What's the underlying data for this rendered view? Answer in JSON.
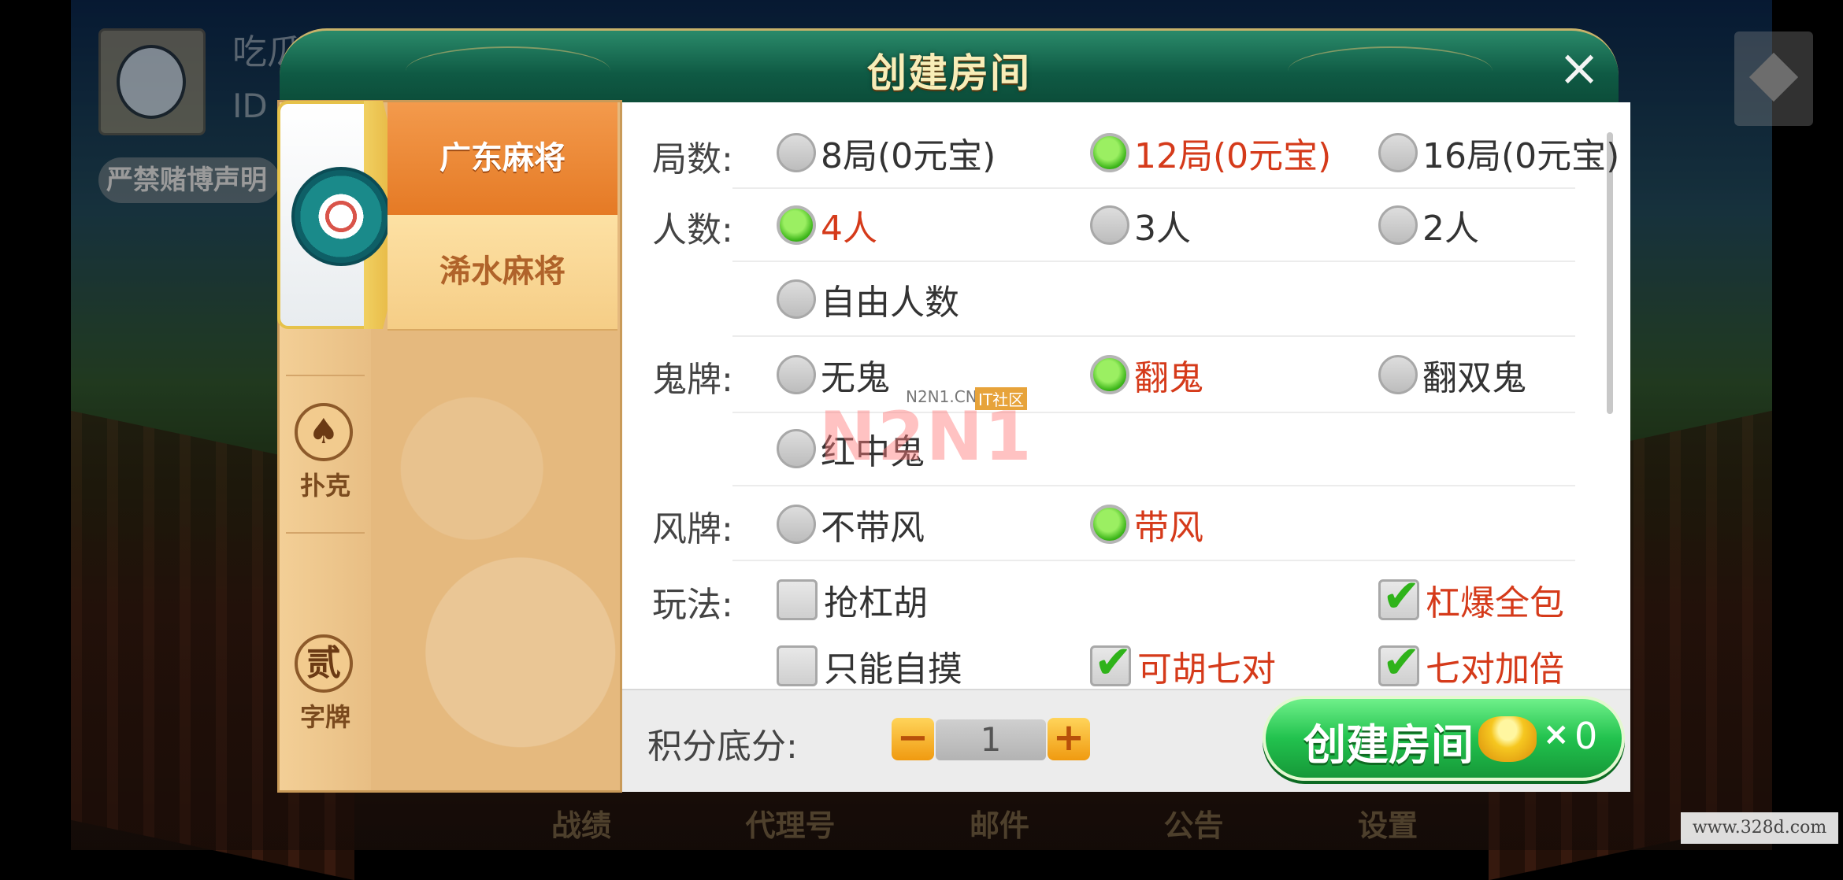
{
  "background": {
    "profile_name": "吃瓜群众",
    "profile_id": "ID",
    "notice": "严禁赌博声明",
    "bottom_nav": [
      "战绩",
      "代理号",
      "邮件",
      "公告",
      "设置"
    ],
    "site_watermark": "www.328d.com"
  },
  "dialog": {
    "title": "创建房间",
    "close_label": "×"
  },
  "categories": [
    {
      "icon": "mahjong-emblem-icon",
      "label": ""
    },
    {
      "icon": "spade-icon",
      "glyph": "♠",
      "label": "扑克"
    },
    {
      "icon": "er-icon",
      "glyph": "贰",
      "label": "字牌"
    }
  ],
  "game_tabs": [
    {
      "label": "广东麻将",
      "active": true
    },
    {
      "label": "浠水麻将",
      "active": false
    }
  ],
  "rules": {
    "rounds": {
      "label": "局数:",
      "options": [
        {
          "text": "8局(0元宝)",
          "selected": false
        },
        {
          "text": "12局(0元宝)",
          "selected": true
        },
        {
          "text": "16局(0元宝)",
          "selected": false
        }
      ]
    },
    "players": {
      "label": "人数:",
      "options": [
        {
          "text": "4人",
          "selected": true
        },
        {
          "text": "3人",
          "selected": false
        },
        {
          "text": "2人",
          "selected": false
        },
        {
          "text": "自由人数",
          "selected": false
        }
      ]
    },
    "ghost": {
      "label": "鬼牌:",
      "options": [
        {
          "text": "无鬼",
          "selected": false
        },
        {
          "text": "翻鬼",
          "selected": true
        },
        {
          "text": "翻双鬼",
          "selected": false
        },
        {
          "text": "红中鬼",
          "selected": false
        }
      ]
    },
    "wind": {
      "label": "风牌:",
      "options": [
        {
          "text": "不带风",
          "selected": false
        },
        {
          "text": "带风",
          "selected": true
        }
      ]
    },
    "play": {
      "label": "玩法:",
      "options": [
        {
          "text": "抢杠胡",
          "checked": false
        },
        {
          "text": "杠爆全包",
          "checked": true
        },
        {
          "text": "只能自摸",
          "checked": false
        },
        {
          "text": "可胡七对",
          "checked": true
        },
        {
          "text": "七对加倍",
          "checked": true
        }
      ]
    }
  },
  "overlay_watermark": {
    "small": "N2N1.CN",
    "tag": "IT社区",
    "big": "N2N1"
  },
  "footer": {
    "score_label": "积分底分:",
    "minus": "−",
    "plus": "+",
    "score_value": "1",
    "create_label": "创建房间",
    "times": "×",
    "cost": "0"
  },
  "colors": {
    "header_green": "#0f5a44",
    "tab_active": "#e57a25",
    "selected_text": "#d53a1a",
    "create_button": "#22c24e"
  }
}
